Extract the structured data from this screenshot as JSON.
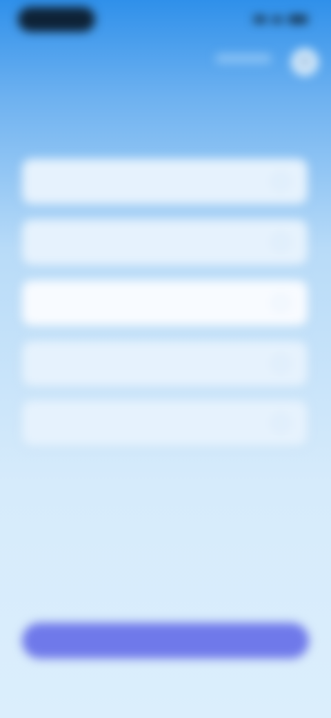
{
  "status_bar": {
    "time": "",
    "signal_icon": "signal-icon",
    "wifi_icon": "wifi-icon",
    "battery_icon": "battery-icon"
  },
  "header": {
    "nav_label": "",
    "close_icon": "close-icon",
    "close_glyph": "✕"
  },
  "main": {
    "title": "",
    "options": [
      {
        "label": ""
      },
      {
        "label": ""
      },
      {
        "label": ""
      },
      {
        "label": ""
      },
      {
        "label": ""
      }
    ],
    "selected_index": 2
  },
  "footer": {
    "note": "",
    "primary_button": "",
    "secondary_link": ""
  },
  "colors": {
    "accent": "#6f79ea",
    "title": "#2d54c9",
    "background_top": "#2f90ea",
    "background_bottom": "#dbeefc"
  }
}
